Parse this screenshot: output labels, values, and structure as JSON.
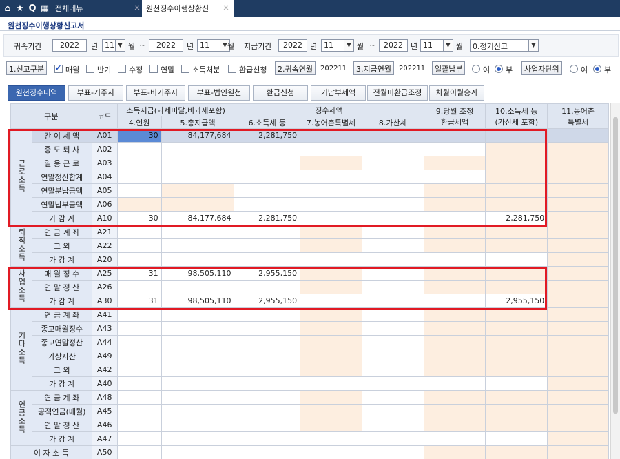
{
  "topbar": {
    "tab1": "전체메뉴",
    "tab2": "원천징수이행상황신",
    "close": "×"
  },
  "page_title": "원천징수이행상황신고서",
  "filters": {
    "attribution_label": "귀속기간",
    "attr_from_year": "2022",
    "year_unit": "년",
    "attr_from_month": "11",
    "month_unit": "월",
    "tilde": "~",
    "attr_to_year": "2022",
    "attr_to_month": "11",
    "payment_label": "지급기간",
    "pay_from_year": "2022",
    "pay_from_month": "11",
    "pay_to_year": "2022",
    "pay_to_month": "11",
    "report_type": "0.정기신고"
  },
  "options": {
    "report_kind_btn": "1.신고구분",
    "monthly": "매월",
    "half": "반기",
    "amend": "수정",
    "year_end": "연말",
    "income_disposal": "소득처분",
    "refund_apply": "환급신청",
    "attr_ym_btn": "2.귀속연월",
    "attr_ym_value": "202211",
    "pay_ym_btn": "3.지급연월",
    "pay_ym_value": "202211",
    "bulk_btn": "일괄납부",
    "yes": "여",
    "no": "부",
    "unit_btn": "사업자단위"
  },
  "tabs": [
    "원천징수내역",
    "부표-거주자",
    "부표-비거주자",
    "부표-법인원천",
    "환급신청",
    "기납부세액",
    "전월미환급조정",
    "차월이월승계"
  ],
  "table": {
    "headers": {
      "category": "구분",
      "code": "코드",
      "payment_group": "소득지급(과세미달,비과세포함)",
      "tax_group": "징수세액",
      "people": "4.인원",
      "total_pay": "5.총지급액",
      "income_tax": "6.소득세 등",
      "rural_tax": "7.농어촌특별세",
      "penalty": "8.가산세",
      "adjust_refund_1": "9.당월 조정",
      "adjust_refund_2": "환급세액",
      "payable_1": "10.소득세 등",
      "payable_2": "(가산세 포함)",
      "rural_payable_1": "11.농어촌",
      "rural_payable_2": "특별세"
    },
    "groups": {
      "labor": "근로소득",
      "retire": "퇴직소득",
      "business": "사업소득",
      "other": "기타소득",
      "pension": "연금소득"
    },
    "rows": [
      {
        "label": "간 이 세 액",
        "code": "A01",
        "people": "30",
        "total": "84,177,684",
        "tax": "2,281,750",
        "payable": ""
      },
      {
        "label": "중 도 퇴 사",
        "code": "A02",
        "people": "",
        "total": "",
        "tax": "",
        "payable": ""
      },
      {
        "label": "일 용 근 로",
        "code": "A03",
        "people": "",
        "total": "",
        "tax": "",
        "payable": ""
      },
      {
        "label": "연말정산합계",
        "code": "A04",
        "people": "",
        "total": "",
        "tax": "",
        "payable": ""
      },
      {
        "label": "연말분납금액",
        "code": "A05",
        "people": "",
        "total": "",
        "tax": "",
        "payable": ""
      },
      {
        "label": "연말납부금액",
        "code": "A06",
        "people": "",
        "total": "",
        "tax": "",
        "payable": ""
      },
      {
        "label": "가 감 계",
        "code": "A10",
        "people": "30",
        "total": "84,177,684",
        "tax": "2,281,750",
        "payable": "2,281,750"
      },
      {
        "label": "연 금 계 좌",
        "code": "A21",
        "people": "",
        "total": "",
        "tax": "",
        "payable": ""
      },
      {
        "label": "그 외",
        "code": "A22",
        "people": "",
        "total": "",
        "tax": "",
        "payable": ""
      },
      {
        "label": "가 감 계",
        "code": "A20",
        "people": "",
        "total": "",
        "tax": "",
        "payable": ""
      },
      {
        "label": "매 월 징 수",
        "code": "A25",
        "people": "31",
        "total": "98,505,110",
        "tax": "2,955,150",
        "payable": ""
      },
      {
        "label": "연 말 정 산",
        "code": "A26",
        "people": "",
        "total": "",
        "tax": "",
        "payable": ""
      },
      {
        "label": "가 감 계",
        "code": "A30",
        "people": "31",
        "total": "98,505,110",
        "tax": "2,955,150",
        "payable": "2,955,150"
      },
      {
        "label": "연 금 계 좌",
        "code": "A41",
        "people": "",
        "total": "",
        "tax": "",
        "payable": ""
      },
      {
        "label": "종교매월징수",
        "code": "A43",
        "people": "",
        "total": "",
        "tax": "",
        "payable": ""
      },
      {
        "label": "종교연말정산",
        "code": "A44",
        "people": "",
        "total": "",
        "tax": "",
        "payable": ""
      },
      {
        "label": "가상자산",
        "code": "A49",
        "people": "",
        "total": "",
        "tax": "",
        "payable": ""
      },
      {
        "label": "그 외",
        "code": "A42",
        "people": "",
        "total": "",
        "tax": "",
        "payable": ""
      },
      {
        "label": "가 감 계",
        "code": "A40",
        "people": "",
        "total": "",
        "tax": "",
        "payable": ""
      },
      {
        "label": "연 금 계 좌",
        "code": "A48",
        "people": "",
        "total": "",
        "tax": "",
        "payable": ""
      },
      {
        "label": "공적연금(매월)",
        "code": "A45",
        "people": "",
        "total": "",
        "tax": "",
        "payable": ""
      },
      {
        "label": "연 말 정 산",
        "code": "A46",
        "people": "",
        "total": "",
        "tax": "",
        "payable": ""
      },
      {
        "label": "가 감 계",
        "code": "A47",
        "people": "",
        "total": "",
        "tax": "",
        "payable": ""
      },
      {
        "label": "이 자 소 득",
        "code": "A50",
        "people": "",
        "total": "",
        "tax": "",
        "payable": ""
      }
    ]
  },
  "colors": {
    "topbar": "#1f3c62",
    "active_tab": "#3b67b0",
    "header_bg": "#dfe6f1",
    "peach": "#fdeee0",
    "highlight": "#e11a24",
    "selected": "#5b8ad6"
  }
}
